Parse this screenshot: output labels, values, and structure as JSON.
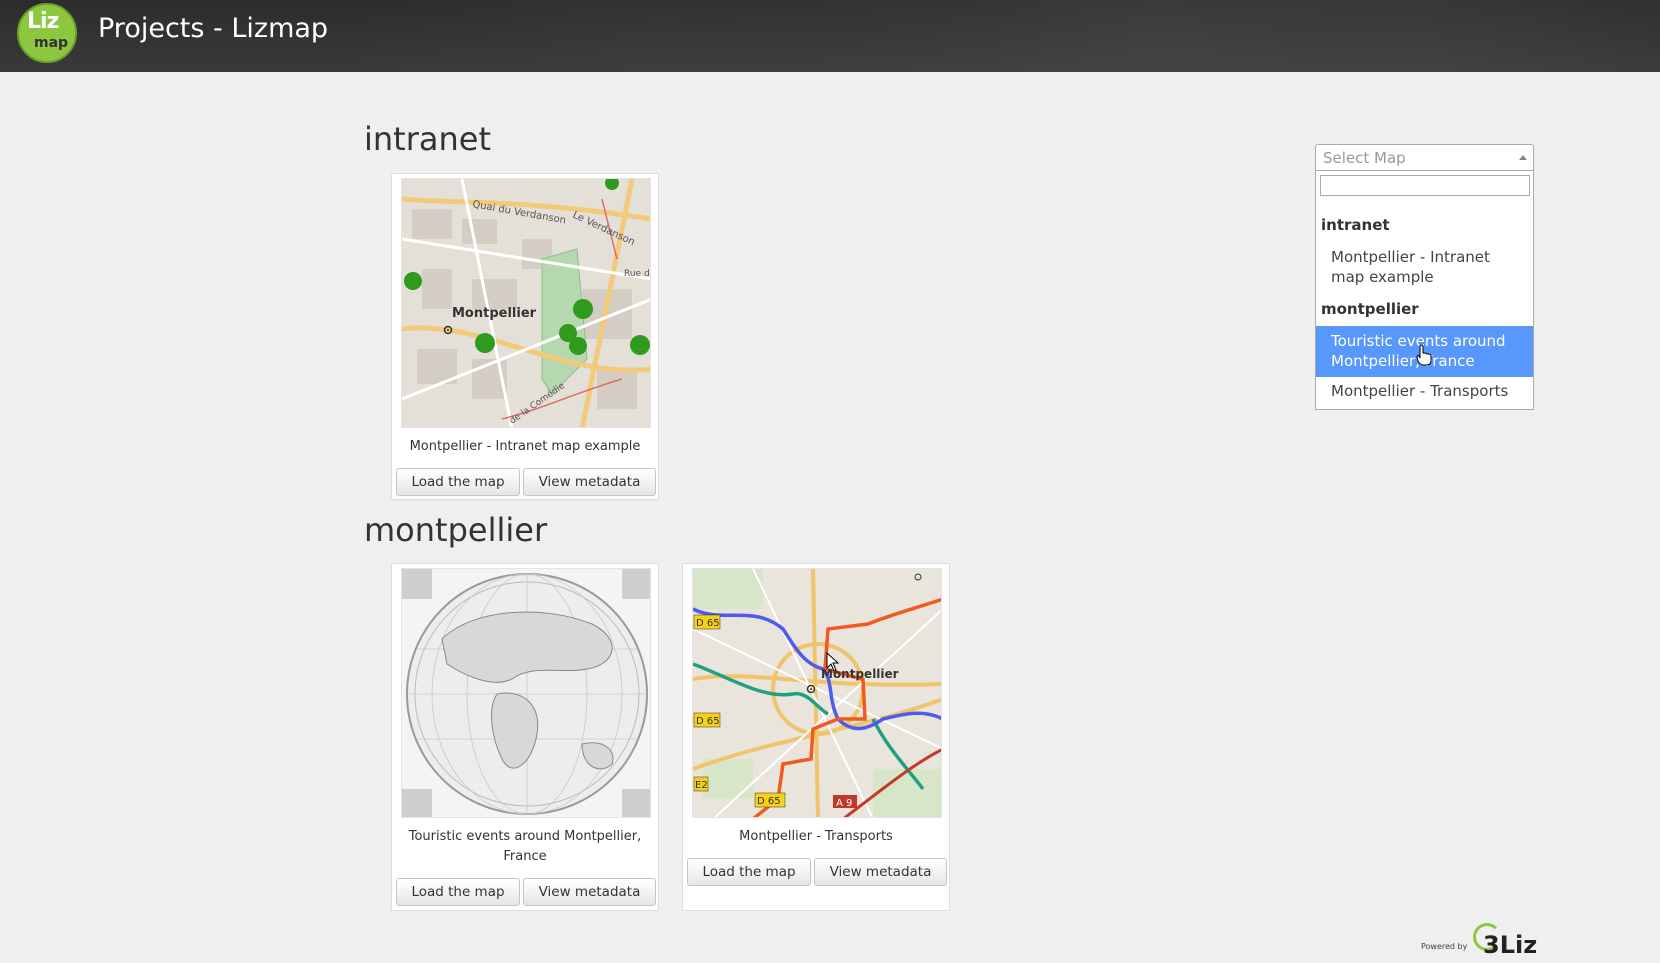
{
  "header": {
    "logo_top": "Liz",
    "logo_bottom": "map",
    "title": "Projects - Lizmap"
  },
  "sections": [
    {
      "name": "intranet",
      "projects": [
        {
          "title": "Montpellier - Intranet map example",
          "thumb_label": "Montpellier",
          "load_label": "Load the map",
          "meta_label": "View metadata"
        }
      ]
    },
    {
      "name": "montpellier",
      "projects": [
        {
          "title": "Touristic events around Montpellier, France",
          "load_label": "Load the map",
          "meta_label": "View metadata"
        },
        {
          "title": "Montpellier - Transports",
          "thumb_label": "Montpellier",
          "load_label": "Load the map",
          "meta_label": "View metadata"
        }
      ]
    }
  ],
  "map_labels": {
    "street1": "Quai du Verdanson",
    "street2": "Le Verdanson",
    "street3": "Rue d'",
    "street4": "de la Comédie",
    "road_d65a": "D 65",
    "road_d65b": "D 65",
    "road_d65c": "D 65",
    "road_e2": "E2",
    "road_a9": "A 9"
  },
  "select_map": {
    "placeholder": "Select Map",
    "search_value": "",
    "groups": [
      {
        "label": "intranet",
        "options": [
          "Montpellier - Intranet map example"
        ]
      },
      {
        "label": "montpellier",
        "options": [
          "Touristic events around Montpellier, France",
          "Montpellier - Transports"
        ]
      }
    ],
    "highlighted": "Touristic events around Montpellier, France"
  },
  "footer": {
    "powered_by": "Powered by",
    "brand": "3Liz"
  },
  "colors": {
    "accent_highlight": "#5897fb",
    "logo_green": "#8dc63f",
    "header_bg": "#333333"
  }
}
